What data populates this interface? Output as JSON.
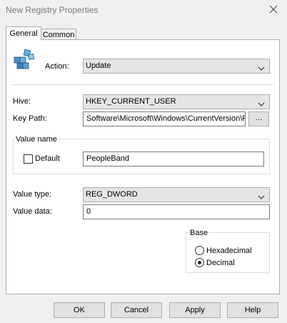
{
  "window": {
    "title": "New Registry Properties"
  },
  "tabs": [
    {
      "label": "General",
      "active": true
    },
    {
      "label": "Common",
      "active": false
    }
  ],
  "form": {
    "action_label": "Action:",
    "action_value": "Update",
    "hive_label": "Hive:",
    "hive_value": "HKEY_CURRENT_USER",
    "keypath_label": "Key Path:",
    "keypath_value": "Software\\Microsoft\\Windows\\CurrentVersion\\F",
    "browse_label": "...",
    "value_name_group": "Value name",
    "default_label": "Default",
    "default_checked": false,
    "value_name": "PeopleBand",
    "value_type_label": "Value type:",
    "value_type": "REG_DWORD",
    "value_data_label": "Value data:",
    "value_data": "0",
    "base_group": "Base",
    "base_options": [
      {
        "label": "Hexadecimal",
        "selected": false
      },
      {
        "label": "Decimal",
        "selected": true
      }
    ]
  },
  "buttons": {
    "ok": "OK",
    "cancel": "Cancel",
    "apply": "Apply",
    "help": "Help"
  },
  "icons": {
    "close": "close-icon",
    "registry": "registry-icon",
    "dropdown": "chevron-down-icon"
  }
}
